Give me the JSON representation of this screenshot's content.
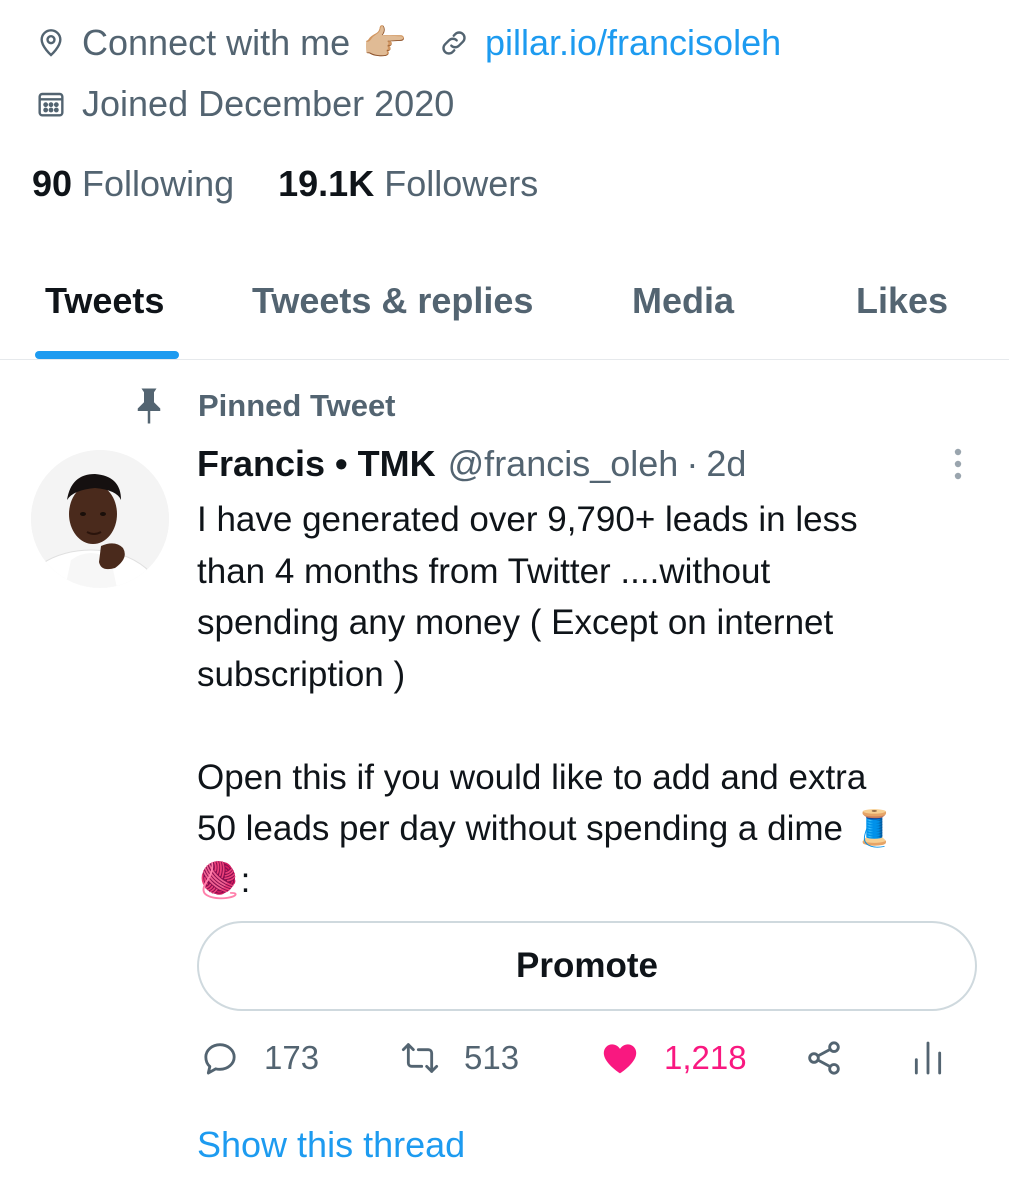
{
  "profile": {
    "location": "Connect with me",
    "location_emoji": "👉🏼",
    "website": "pillar.io/francisoleh",
    "joined": "Joined December 2020",
    "following_count": "90",
    "following_label": "Following",
    "followers_count": "19.1K",
    "followers_label": "Followers"
  },
  "tabs": [
    {
      "label": "Tweets",
      "active": true
    },
    {
      "label": "Tweets & replies",
      "active": false
    },
    {
      "label": "Media",
      "active": false
    },
    {
      "label": "Likes",
      "active": false
    }
  ],
  "tweet": {
    "pinned_label": "Pinned Tweet",
    "author_name": "Francis • TMK",
    "handle": "@francis_oleh",
    "separator": "·",
    "time": "2d",
    "text": "I have generated over 9,790+ leads in less\nthan 4 months from Twitter ....without\nspending any money ( Except on internet\nsubscription )\n\nOpen this if you would like to add and extra\n50 leads per day without spending a dime 🧵\n🧶:",
    "promote_label": "Promote",
    "replies": "173",
    "retweets": "513",
    "likes": "1,218",
    "show_thread": "Show this thread"
  },
  "colors": {
    "accent": "#1d9bf0",
    "like": "#f91880",
    "secondary_text": "#536471"
  },
  "icons": [
    "location-icon",
    "link-icon",
    "calendar-icon",
    "pin-icon",
    "more-icon",
    "reply-icon",
    "retweet-icon",
    "heart-icon",
    "share-icon",
    "analytics-icon"
  ]
}
